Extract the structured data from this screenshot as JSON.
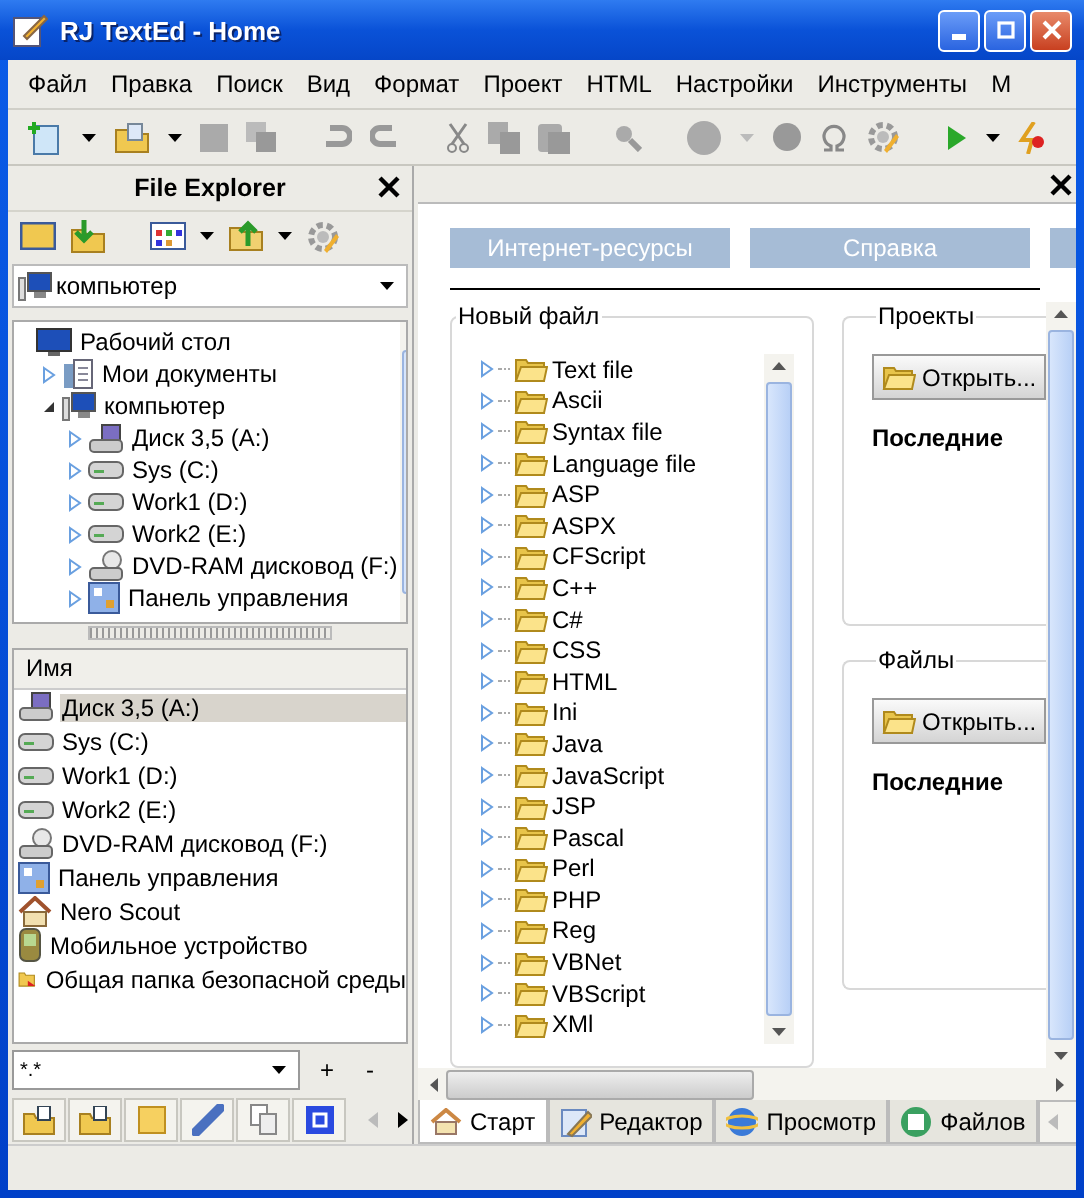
{
  "window": {
    "title": "RJ TextEd - Home"
  },
  "menu": [
    {
      "label": "Файл"
    },
    {
      "label": "Правка"
    },
    {
      "label": "Поиск"
    },
    {
      "label": "Вид"
    },
    {
      "label": "Формат"
    },
    {
      "label": "Проект"
    },
    {
      "label": "HTML"
    },
    {
      "label": "Настройки"
    },
    {
      "label": "Инструменты"
    },
    {
      "label": "М"
    }
  ],
  "explorer": {
    "title": "File Explorer",
    "location": "компьютер",
    "tree": [
      {
        "label": "Рабочий стол",
        "kind": "desktop",
        "children": [
          {
            "label": "Мои документы",
            "kind": "documents",
            "expanded": false
          },
          {
            "label": "компьютер",
            "kind": "computer",
            "expanded": true,
            "children": [
              {
                "label": "Диск 3,5 (A:)",
                "kind": "floppy",
                "expanded": false
              },
              {
                "label": "Sys (C:)",
                "kind": "drive",
                "expanded": false
              },
              {
                "label": "Work1 (D:)",
                "kind": "drive",
                "expanded": false
              },
              {
                "label": "Work2 (E:)",
                "kind": "drive",
                "expanded": false
              },
              {
                "label": "DVD-RAM дисковод (F:)",
                "kind": "dvd",
                "expanded": false
              },
              {
                "label": "Панель управления",
                "kind": "control-panel",
                "expanded": false
              }
            ]
          }
        ]
      }
    ],
    "column": "Имя",
    "items": [
      {
        "label": "Диск 3,5 (A:)",
        "kind": "floppy",
        "selected": true
      },
      {
        "label": "Sys (C:)",
        "kind": "drive",
        "selected": false
      },
      {
        "label": "Work1 (D:)",
        "kind": "drive",
        "selected": false
      },
      {
        "label": "Work2 (E:)",
        "kind": "drive",
        "selected": false
      },
      {
        "label": "DVD-RAM дисковод (F:)",
        "kind": "dvd",
        "selected": false
      },
      {
        "label": "Панель управления",
        "kind": "control-panel",
        "selected": false
      },
      {
        "label": "Nero Scout",
        "kind": "scout",
        "selected": false
      },
      {
        "label": "Мобильное устройство",
        "kind": "mobile",
        "selected": false
      },
      {
        "label": "Общая папка безопасной среды",
        "kind": "shared-folder",
        "selected": false
      }
    ],
    "filter": "*.*",
    "add": "+",
    "remove": "-"
  },
  "start": {
    "links": [
      "Интернет-ресурсы",
      "Справка"
    ],
    "new_file": {
      "title": "Новый файл",
      "items": [
        "Text file",
        "Ascii",
        "Syntax file",
        "Language file",
        "ASP",
        "ASPX",
        "CFScript",
        "C++",
        "C#",
        "CSS",
        "HTML",
        "Ini",
        "Java",
        "JavaScript",
        "JSP",
        "Pascal",
        "Perl",
        "PHP",
        "Reg",
        "VBNet",
        "VBScript",
        "XMl"
      ]
    },
    "groups": [
      {
        "title": "Проекты",
        "open": "Открыть...",
        "recent": "Последние"
      },
      {
        "title": "Файлы",
        "open": "Открыть...",
        "recent": "Последние"
      }
    ]
  },
  "doc_tabs": [
    {
      "label": "Старт",
      "kind": "home",
      "selected": true
    },
    {
      "label": "Редактор",
      "kind": "editor",
      "selected": false
    },
    {
      "label": "Просмотр",
      "kind": "browser",
      "selected": false
    },
    {
      "label": "Файлов",
      "kind": "disk",
      "selected": false
    }
  ]
}
